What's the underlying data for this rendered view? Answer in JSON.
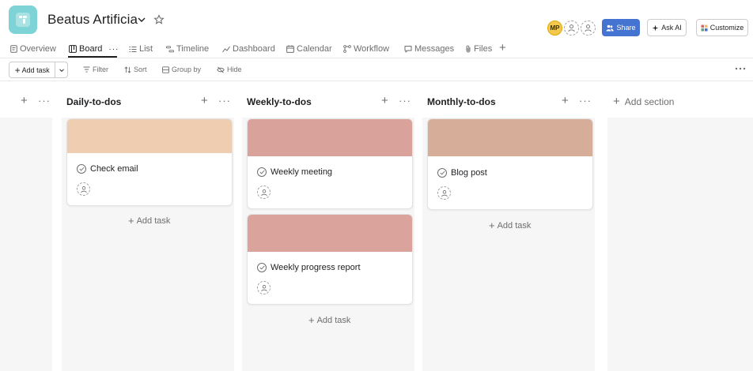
{
  "project": {
    "title": "Beatus Artificia",
    "icon": "board-icon",
    "icon_color": "#7dd3d6"
  },
  "header_right": {
    "avatar_initials": "MP",
    "share_label": "Share",
    "askai_label": "Ask AI",
    "customize_label": "Customize",
    "share_color": "#4573d2"
  },
  "tabs": [
    {
      "label": "Overview",
      "icon": "overview-icon"
    },
    {
      "label": "Board",
      "icon": "board-icon",
      "active": true
    },
    {
      "label": "List",
      "icon": "list-icon"
    },
    {
      "label": "Timeline",
      "icon": "timeline-icon"
    },
    {
      "label": "Dashboard",
      "icon": "dashboard-icon"
    },
    {
      "label": "Calendar",
      "icon": "calendar-icon"
    },
    {
      "label": "Workflow",
      "icon": "workflow-icon"
    },
    {
      "label": "Messages",
      "icon": "messages-icon"
    },
    {
      "label": "Files",
      "icon": "files-icon"
    }
  ],
  "toolbar": {
    "add_task": "Add task",
    "filter": "Filter",
    "sort": "Sort",
    "group_by": "Group by",
    "hide": "Hide"
  },
  "board": {
    "columns": [
      {
        "title": "Daily-to-dos",
        "add_task": "Add task",
        "tasks": [
          {
            "title": "Check email",
            "cover": "#efcdb1"
          }
        ]
      },
      {
        "title": "Weekly-to-dos",
        "add_task": "Add task",
        "tasks": [
          {
            "title": "Weekly meeting",
            "cover": "#d9a29a"
          },
          {
            "title": "Weekly progress report",
            "cover": "#daa49c"
          }
        ]
      },
      {
        "title": "Monthly-to-dos",
        "add_task": "Add task",
        "tasks": [
          {
            "title": "Blog post",
            "cover": "#d6ad98"
          }
        ]
      }
    ],
    "add_section": "Add section"
  }
}
